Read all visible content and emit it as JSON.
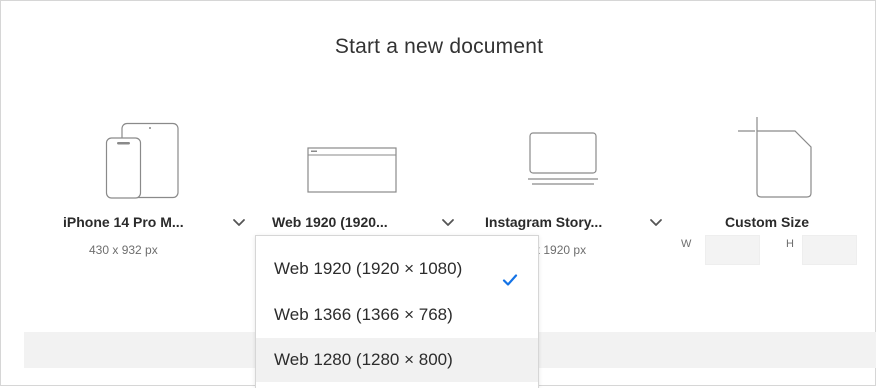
{
  "title": "Start a new document",
  "presets": [
    {
      "label": "iPhone 14 Pro M...",
      "size": "430 x 932 px",
      "icon": "phone-tablet-icon"
    },
    {
      "label": "Web 1920 (1920...",
      "size": "",
      "icon": "browser-window-icon"
    },
    {
      "label": "Instagram Story...",
      "size": "1080 x 1920 px",
      "icon": "laptop-document-icon"
    },
    {
      "label": "Custom Size",
      "icon": "blank-document-icon"
    }
  ],
  "custom": {
    "w_label": "W",
    "h_label": "H",
    "w_value": "",
    "h_value": ""
  },
  "dropdown": {
    "items": [
      {
        "label": "Web 1920 (1920 × 1080)",
        "selected": true
      },
      {
        "label": "Web 1366 (1366 × 768)",
        "selected": false
      },
      {
        "label": "Web 1280 (1280 × 800)",
        "selected": false,
        "hover": true
      }
    ]
  },
  "colors": {
    "check": "#1473e6",
    "icon_stroke": "#8a8a8a",
    "footer": "#f2f2f2"
  }
}
